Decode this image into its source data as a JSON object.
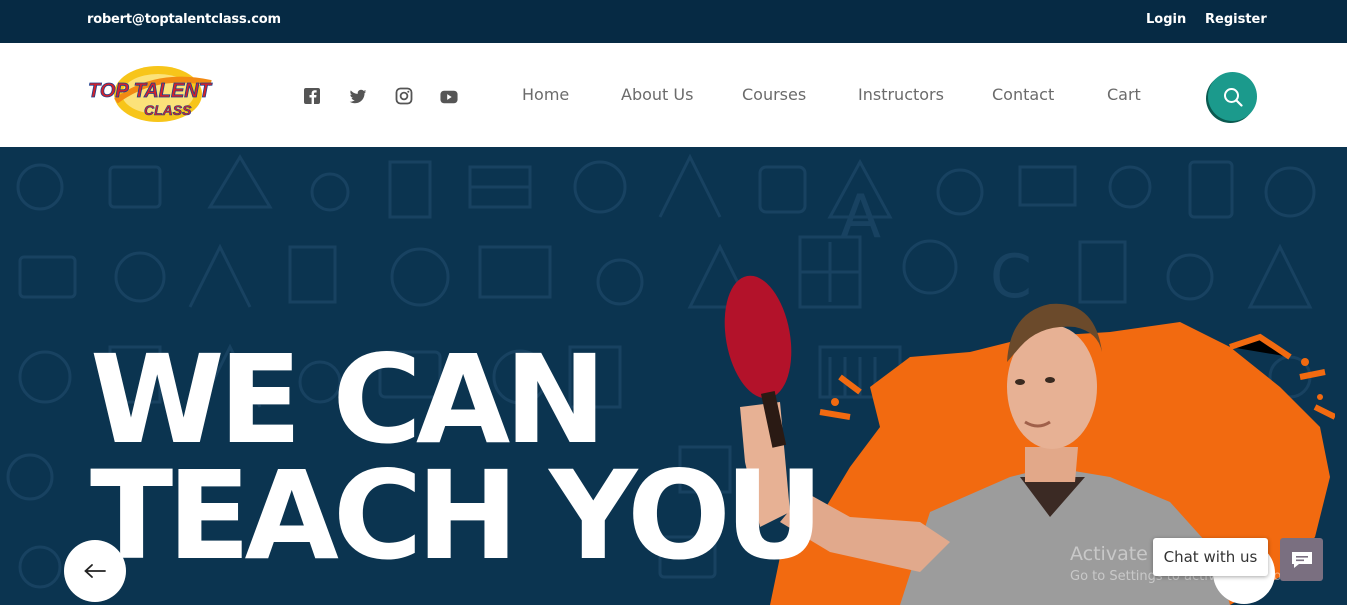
{
  "topbar": {
    "email": "robert@toptalentclass.com",
    "login": "Login",
    "register": "Register"
  },
  "logo": {
    "line1": "TOP TALENT",
    "line2": "CLASS"
  },
  "socials": [
    "facebook-icon",
    "twitter-icon",
    "instagram-icon",
    "youtube-icon"
  ],
  "nav": {
    "home": "Home",
    "about": "About Us",
    "courses": "Courses",
    "instructors": "Instructors",
    "contact": "Contact",
    "cart": "Cart"
  },
  "hero": {
    "line1": "WE CAN",
    "line2": "TEACH YOU"
  },
  "watermark": {
    "title": "Activate Windows",
    "subtitle": "Go to Settings to activate Windows."
  },
  "chat": {
    "label": "Chat with us"
  },
  "colors": {
    "topbar": "#062a44",
    "hero": "#0b3450",
    "accent_teal": "#1b9a8c",
    "splash_orange": "#f26a10"
  }
}
